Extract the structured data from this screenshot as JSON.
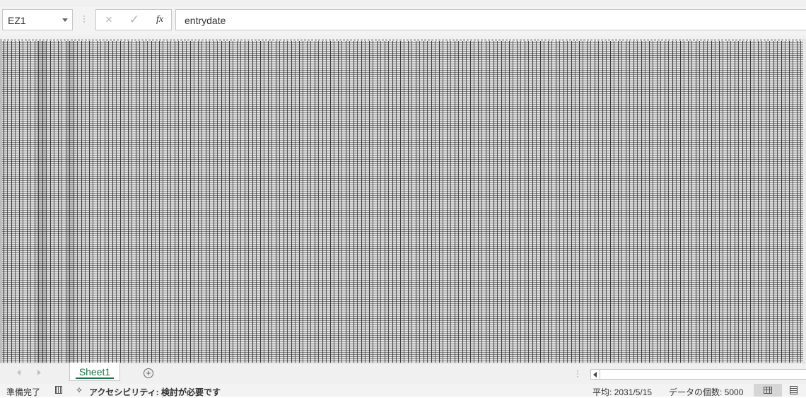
{
  "formula_bar": {
    "name_box": "EZ1",
    "cancel_icon": "×",
    "enter_icon": "✓",
    "fx_label": "fx",
    "formula_value": "entrydate"
  },
  "sheet_tabs": {
    "tabs": [
      {
        "label": "Sheet1",
        "active": true
      }
    ],
    "add_icon": "+"
  },
  "status_bar": {
    "ready": "準備完了",
    "accessibility": "アクセシビリティ: 検討が必要です",
    "average": "平均: 2031/5/15",
    "count": "データの個数: 5000"
  },
  "colors": {
    "accent": "#217346",
    "chrome": "#f3f3f3",
    "border": "#c6c6c6"
  }
}
